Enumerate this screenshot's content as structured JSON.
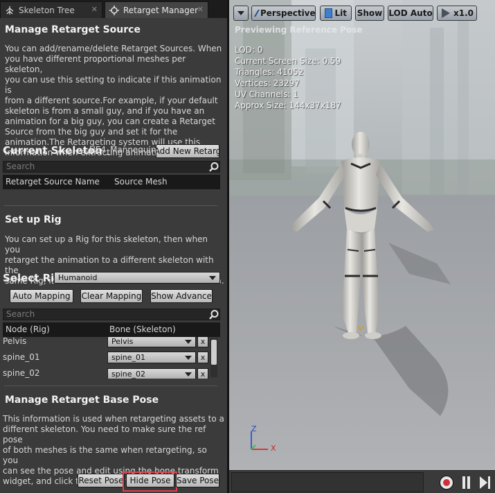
{
  "tabs": [
    {
      "label": "Skeleton Tree",
      "icon": "skeleton-tree-icon"
    },
    {
      "label": "Retarget Manager",
      "icon": "retarget-manager-icon"
    }
  ],
  "retarget_source": {
    "title": "Manage Retarget Source",
    "description_lines": [
      "You can add/rename/delete Retarget Sources. When",
      "you have different proportional meshes per skeleton,",
      "you can use this setting to indicate if this animation is",
      "from a different source.For example, if your default",
      "skeleton is from a small guy, and if you have an",
      "animation for a big guy, you can create a Retarget",
      "Source from the big guy and set it for the",
      "animation.The Retargeting system will use this",
      "information when extracting animation."
    ],
    "current_skeleton_label": "Current Skeleton",
    "current_skeleton_value": "UE4_Mannequin_S",
    "add_button": "Add New Retarg",
    "search_placeholder": "Search",
    "columns": [
      "Retarget Source Name",
      "Source Mesh"
    ]
  },
  "rig": {
    "title": "Set up Rig",
    "description_lines": [
      "You can set up a Rig for this skeleton, then when you",
      "retarget the animation to a different skeleton with the",
      "same Rig, it will use the information to convert data."
    ],
    "select_label": "Select Rig",
    "selected_rig": "Humanoid",
    "buttons": {
      "auto": "Auto  Mapping",
      "clear": "Clear Mapping",
      "advanced": "Show Advance"
    },
    "search_placeholder": "Search",
    "columns": [
      "Node (Rig)",
      "Bone (Skeleton)"
    ],
    "rows": [
      {
        "node": "Pelvis",
        "bone": "Pelvis"
      },
      {
        "node": "spine_01",
        "bone": "spine_01"
      },
      {
        "node": "spine_02",
        "bone": "spine_02"
      }
    ],
    "remove_label": "x"
  },
  "base_pose": {
    "title": "Manage Retarget Base Pose",
    "description_lines": [
      "This information is used when retargeting assets to a",
      "different skeleton. You need to make sure the ref pose",
      "of both meshes is the same when retargeting, so you",
      "can see the pose and edit using the bone transform",
      "widget, and click the Save button below."
    ],
    "buttons": {
      "reset": "Reset Pose",
      "hide": "Hide Pose",
      "save": "Save Pose"
    }
  },
  "viewport": {
    "toolbar": {
      "perspective": "Perspective",
      "lit": "Lit",
      "show": "Show",
      "lod": "LOD Auto",
      "speed": "x1.0"
    },
    "preview_text": "Previewing Reference Pose",
    "stats": [
      "LOD: 0",
      "Current Screen Size: 0.59",
      "Triangles: 41052",
      "Vertices: 23297",
      "UV Channels: 1",
      "Approx Size: 144x37x187"
    ],
    "axes": {
      "z": "Z",
      "x": "X"
    }
  },
  "colors": {
    "highlight": "#e0404a",
    "panel": "#3b3b3b",
    "record": "#d0303a"
  }
}
